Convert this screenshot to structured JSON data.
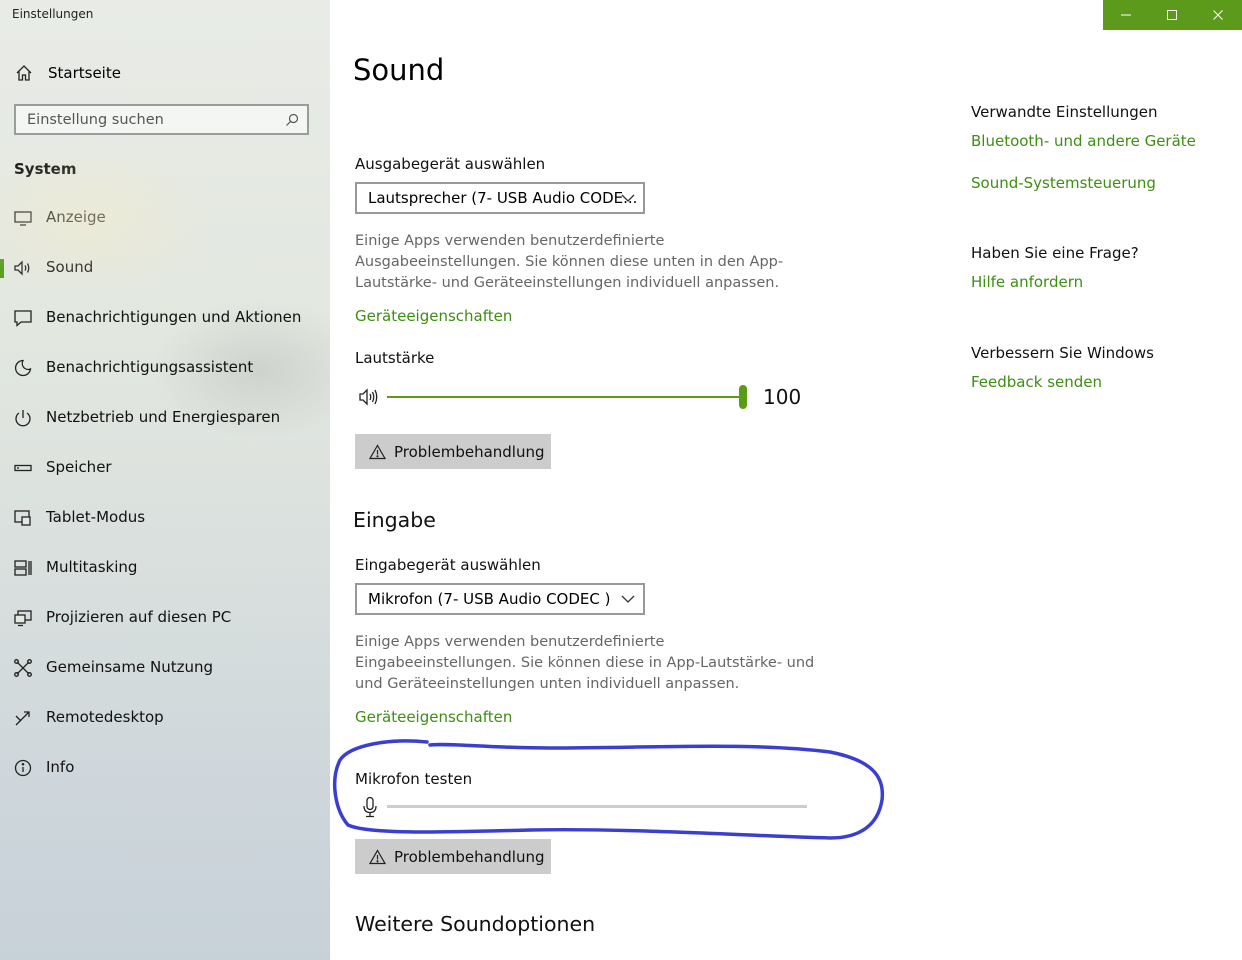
{
  "window": {
    "title": "Einstellungen",
    "controls": [
      "minimize-icon",
      "maximize-icon",
      "close-icon"
    ],
    "accent_color": "#5b9a1a"
  },
  "sidebar": {
    "home_label": "Startseite",
    "search_placeholder": "Einstellung suchen",
    "section": "System",
    "items": [
      {
        "label": "Anzeige",
        "icon": "monitor-icon"
      },
      {
        "label": "Sound",
        "icon": "speaker-icon",
        "selected": true
      },
      {
        "label": "Benachrichtigungen und Aktionen",
        "icon": "notification-icon"
      },
      {
        "label": "Benachrichtigungsassistent",
        "icon": "moon-icon"
      },
      {
        "label": "Netzbetrieb und Energiesparen",
        "icon": "power-icon"
      },
      {
        "label": "Speicher",
        "icon": "storage-icon"
      },
      {
        "label": "Tablet-Modus",
        "icon": "tablet-icon"
      },
      {
        "label": "Multitasking",
        "icon": "multitasking-icon"
      },
      {
        "label": "Projizieren auf diesen PC",
        "icon": "project-icon"
      },
      {
        "label": "Gemeinsame Nutzung",
        "icon": "share-icon"
      },
      {
        "label": "Remotedesktop",
        "icon": "remote-icon"
      },
      {
        "label": "Info",
        "icon": "info-icon"
      }
    ]
  },
  "main": {
    "title": "Sound",
    "output": {
      "select_label": "Ausgabegerät auswählen",
      "device": "Lautsprecher (7- USB Audio CODE...",
      "description": "Einige Apps verwenden benutzerdefinierte Ausgabeeinstellungen. Sie können diese unten in den App-Lautstärke- und Geräteeinstellungen individuell anpassen.",
      "properties_link": "Geräteeigenschaften",
      "volume_label": "Lautstärke",
      "volume_value": "100",
      "volume_level": 1.0,
      "troubleshoot": "Problembehandlung"
    },
    "input": {
      "heading": "Eingabe",
      "select_label": "Eingabegerät auswählen",
      "device": "Mikrofon (7- USB Audio CODEC )",
      "description": "Einige Apps verwenden benutzerdefinierte Eingabeeinstellungen. Sie können diese in App-Lautstärke- und und Geräteeinstellungen unten individuell anpassen.",
      "properties_link": "Geräteeigenschaften",
      "mic_test_label": "Mikrofon testen",
      "mic_level": 0.0,
      "troubleshoot": "Problembehandlung"
    },
    "more_heading": "Weitere Soundoptionen",
    "annotation_color": "#3a3fcf"
  },
  "related": {
    "heading": "Verwandte Einstellungen",
    "links": [
      "Bluetooth- und andere Geräte",
      "Sound-Systemsteuerung"
    ],
    "question_heading": "Haben Sie eine Frage?",
    "help_link": "Hilfe anfordern",
    "improve_heading": "Verbessern Sie Windows",
    "feedback_link": "Feedback senden"
  }
}
